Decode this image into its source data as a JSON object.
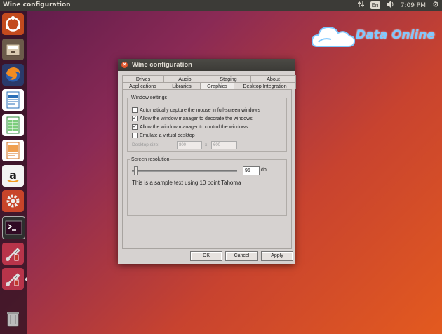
{
  "topbar": {
    "app_title": "Wine configuration",
    "keyboard_lang": "En",
    "clock": "7:09 PM"
  },
  "launcher": {
    "items": [
      "ubuntu-logo-icon",
      "files-icon",
      "firefox-icon",
      "writer-icon",
      "calc-icon",
      "impress-icon",
      "amazon-icon",
      "settings-icon",
      "terminal-icon",
      "wine-config-icon",
      "wine-config-icon-2",
      "trash-icon"
    ]
  },
  "watermark": {
    "text": "Data Online"
  },
  "window": {
    "title": "Wine configuration",
    "tabs_row1": [
      "Drives",
      "Audio",
      "Staging",
      "About"
    ],
    "tabs_row2": [
      "Applications",
      "Libraries",
      "Graphics",
      "Desktop Integration"
    ],
    "active_tab": "Graphics",
    "window_settings": {
      "legend": "Window settings",
      "options": [
        {
          "label": "Automatically capture the mouse in full-screen windows",
          "checked": false
        },
        {
          "label": "Allow the window manager to decorate the windows",
          "checked": true
        },
        {
          "label": "Allow the window manager to control the windows",
          "checked": true
        },
        {
          "label": "Emulate a virtual desktop",
          "checked": false
        }
      ],
      "desktop_size_label": "Desktop size:",
      "width_value": "800",
      "times": "x",
      "height_value": "600"
    },
    "screen_resolution": {
      "legend": "Screen resolution",
      "dpi_value": "96",
      "dpi_unit": "dpi",
      "sample_text": "This is a sample text using 10 point Tahoma"
    },
    "buttons": {
      "ok": "OK",
      "cancel": "Cancel",
      "apply": "Apply"
    }
  }
}
